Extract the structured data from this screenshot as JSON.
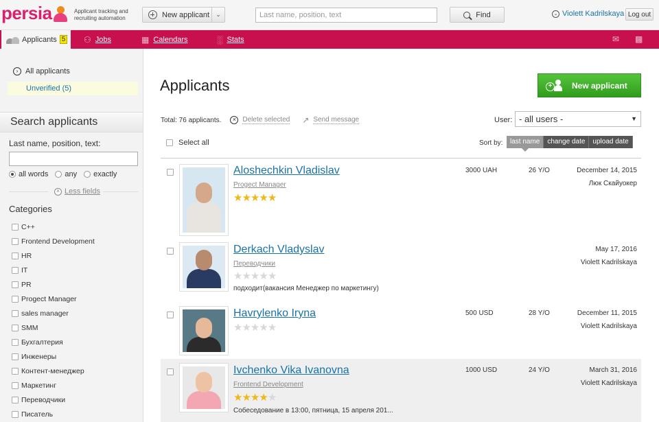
{
  "header": {
    "logo_text": "persia",
    "tagline": "Applicant tracking and recruiting automation",
    "new_applicant_label": "New applicant",
    "search_placeholder": "Last name, position, text",
    "find_label": "Find",
    "user_name": "Violett Kadrilskaya",
    "logout_label": "Log out"
  },
  "nav": {
    "tabs": [
      {
        "label": "Applicants",
        "badge": "5",
        "icon": "people-icon"
      },
      {
        "label": "Jobs",
        "icon": "chair-icon"
      },
      {
        "label": "Calendars",
        "icon": "calendar-icon"
      },
      {
        "label": "Stats",
        "icon": "bar-chart-icon"
      }
    ],
    "right_icons": [
      "mail-icon",
      "chat-icon"
    ]
  },
  "sidebar": {
    "all_applicants": "All applicants",
    "unverified": "Unverified (5)",
    "search_title": "Search applicants",
    "search_label": "Last name, position, text:",
    "search_value": "",
    "match_options": [
      "all words",
      "any",
      "exactly"
    ],
    "match_selected": "all words",
    "less_fields": "Less fields",
    "categories_title": "Categories",
    "categories": [
      "C++",
      "Frontend Development",
      "HR",
      "IT",
      "PR",
      "Progect Manager",
      "sales manager",
      "SMM",
      "Бухгалтерия",
      "Инженеры",
      "Контент-менеджер",
      "Маркетинг",
      "Переводчики",
      "Писатель"
    ]
  },
  "main": {
    "title": "Applicants",
    "new_applicant_label": "New applicant",
    "total": "Total: 76 applicants.",
    "delete_selected": "Delete selected",
    "send_message": "Send message",
    "user_label": "User:",
    "user_filter": "- all users -",
    "select_all": "Select all",
    "sort_by": "Sort by:",
    "sort_options": [
      "last name",
      "change date",
      "upload date"
    ],
    "sort_active": "last name",
    "colors": {
      "accent": "#c8104e",
      "green": "#3aab25",
      "link": "#1a73a8",
      "star": "#f0b816"
    }
  },
  "applicants": [
    {
      "name": "Aloshechkin Vladislav",
      "position": "Progect Manager",
      "rating": 5,
      "salary": "3000 UAH",
      "age": "26 Y/O",
      "date": "December 14, 2015",
      "owner": "Люк Скайуокер",
      "note": ""
    },
    {
      "name": "Derkach Vladyslav",
      "position": "Переводчики",
      "rating": 0,
      "salary": "",
      "age": "",
      "date": "May 17, 2016",
      "owner": "Violett Kadrilskaya",
      "note": "подходит(вакансия Менеджер по маркетингу)"
    },
    {
      "name": "Havrylenko Iryna",
      "position": "",
      "rating": 0,
      "salary": "500 USD",
      "age": "28 Y/O",
      "date": "December 11, 2015",
      "owner": "Violett Kadrilskaya",
      "note": ""
    },
    {
      "name": "Ivchenko Vika Ivanovna",
      "position": "Frontend Development",
      "rating": 4,
      "salary": "1000 USD",
      "age": "24 Y/O",
      "date": "March 31, 2016",
      "owner": "Violett Kadrilskaya",
      "note": "Собеседование в 13:00, пятница, 15 апреля 201..."
    }
  ]
}
